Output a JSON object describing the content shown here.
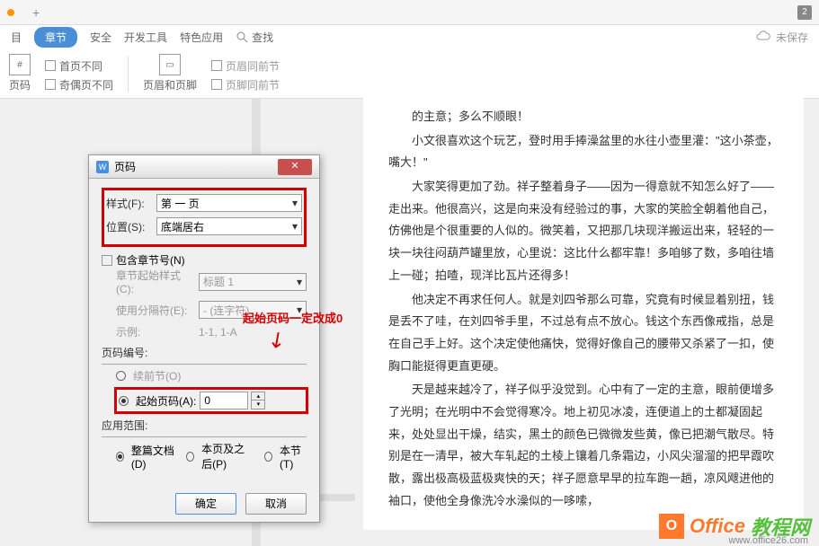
{
  "tabbar": {
    "plus": "+",
    "badge": "2"
  },
  "menu": {
    "items": [
      "目",
      "章节",
      "安全",
      "开发工具",
      "特色应用"
    ],
    "search_label": "查找",
    "unsaved": "未保存"
  },
  "ribbon": {
    "page_number_btn": "页码",
    "checks": [
      "首页不同",
      "奇偶页不同"
    ],
    "header_footer_btn": "页眉和页脚",
    "checks2": [
      "页眉同前节",
      "页脚同前节"
    ]
  },
  "document": {
    "p0": "的主意；多么不顺眼！",
    "p1": "小文很喜欢这个玩艺，登时用手捧澡盆里的水往小壶里灌：\"这小茶壶，嘴大！\"",
    "p2": "大家笑得更加了劲。祥子整着身子——因为一得意就不知怎么好了——走出来。他很高兴，这是向来没有经验过的事，大家的笑脸全朝着他自己，仿佛他是个很重要的人似的。微笑着，又把那几块现洋搬运出来，轻轻的一块一块往闷葫芦罐里放，心里说：这比什么都牢靠！多咱够了数，多咱往墙上一碰；拍喳，现洋比瓦片还得多！",
    "p3": "他决定不再求任何人。就是刘四爷那么可靠，究竟有时候显着别扭，钱是丢不了哇，在刘四爷手里，不过总有点不放心。钱这个东西像戒指，总是在自己手上好。这个决定使他痛快，觉得好像自己的腰带又杀紧了一扣，使胸口能挺得更直更硬。",
    "p4": "天是越来越冷了，祥子似乎没觉到。心中有了一定的主意，眼前便增多了光明；在光明中不会觉得寒冷。地上初见冰凌，连便道上的土都凝固起来，处处显出干燥，结实，黑土的颜色已微微发些黄，像已把潮气散尽。特别是在一清早，被大车轧起的土棱上镶着几条霜边，小风尖溜溜的把早霞吹散，露出极高极蓝极爽快的天；祥子愿意早早的拉车跑一趟，凉风飕进他的袖口，使他全身像洗冷水澡似的一哆嗦，"
  },
  "dialog": {
    "title": "页码",
    "style_label": "样式(F):",
    "style_value": "第 一 页",
    "position_label": "位置(S):",
    "position_value": "底端居右",
    "include_chapter": "包含章节号(N)",
    "chapter_start_label": "章节起始样式(C):",
    "chapter_start_value": "标题 1",
    "separator_label": "使用分隔符(E):",
    "separator_value": "- (连字符)",
    "example_label": "示例:",
    "example_value": "1-1, 1-A",
    "page_numbering": "页码编号:",
    "continue_radio": "续前节(O)",
    "start_radio": "起始页码(A):",
    "start_value": "0",
    "apply_range": "应用范围:",
    "range_whole": "整篇文档(D)",
    "range_from": "本页及之后(P)",
    "range_this": "本节(T)",
    "ok": "确定",
    "cancel": "取消"
  },
  "annotation": {
    "text": "起始页码一定改成0",
    "arrow": "↙"
  },
  "watermark": {
    "brand1": "Office",
    "brand2": "教程网",
    "url": "www.office26.com"
  }
}
